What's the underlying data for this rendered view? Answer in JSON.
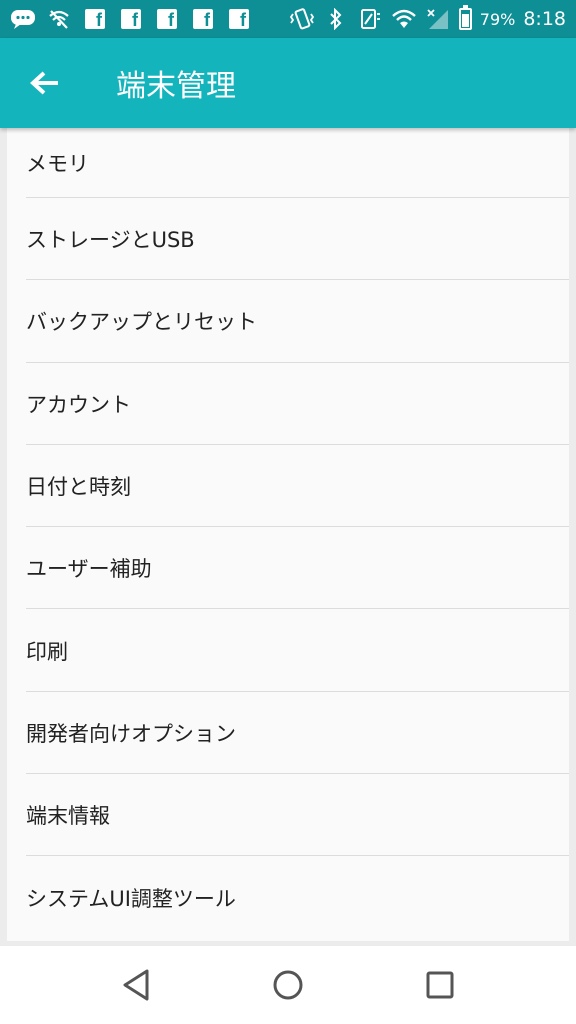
{
  "status_bar": {
    "battery_percent": "79%",
    "time": "8:18",
    "battery_level": 0.79
  },
  "app_bar": {
    "title": "端末管理",
    "back_icon": "arrow-left-icon"
  },
  "settings_list": [
    {
      "label": "メモリ"
    },
    {
      "label": "ストレージとUSB"
    },
    {
      "label": "バックアップとリセット"
    },
    {
      "label": "アカウント"
    },
    {
      "label": "日付と時刻"
    },
    {
      "label": "ユーザー補助"
    },
    {
      "label": "印刷"
    },
    {
      "label": "開発者向けオプション"
    },
    {
      "label": "端末情報"
    },
    {
      "label": "システムUI調整ツール"
    }
  ],
  "colors": {
    "status_bar": "#0e8f96",
    "app_bar": "#14b4bd",
    "list_bg": "#fafafa"
  }
}
